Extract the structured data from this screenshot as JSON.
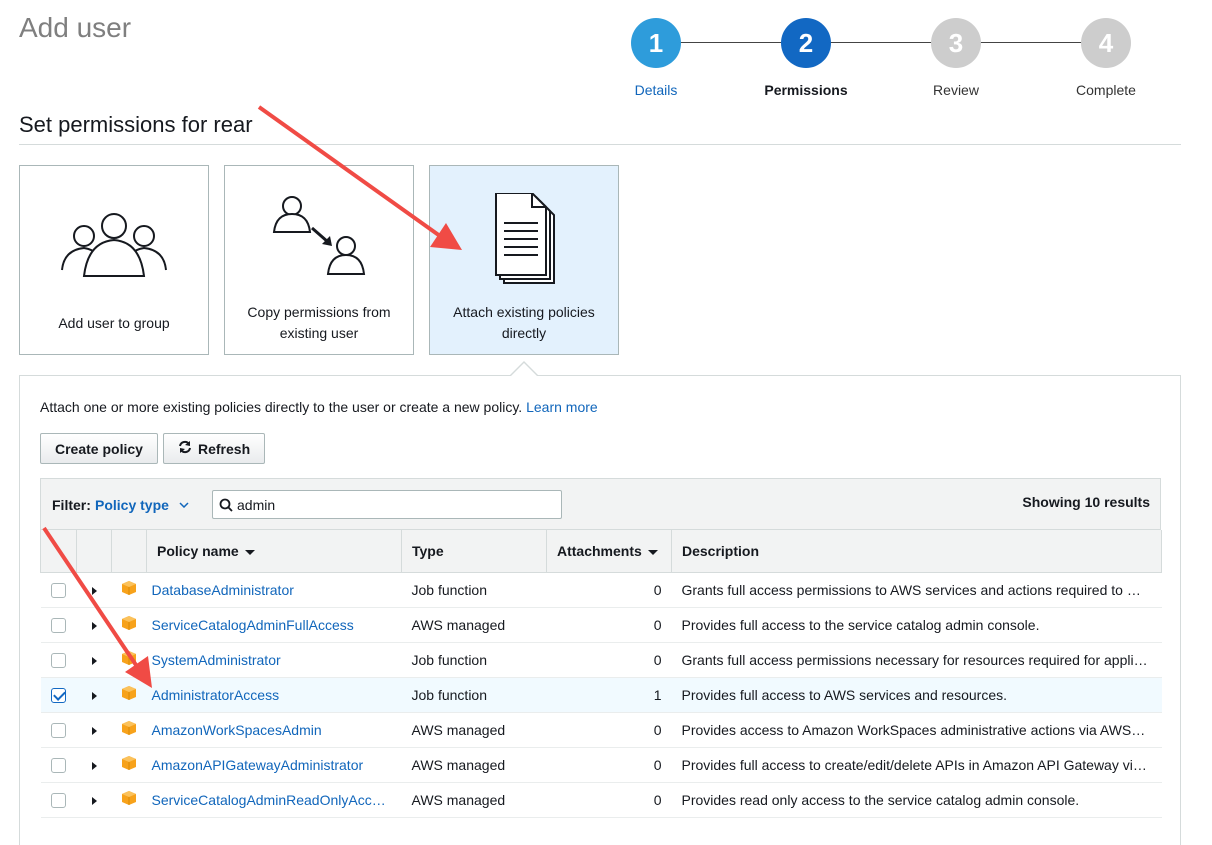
{
  "page": {
    "title": "Add user"
  },
  "stepper": {
    "steps": [
      {
        "number": "1",
        "label": "Details",
        "state": "done"
      },
      {
        "number": "2",
        "label": "Permissions",
        "state": "current"
      },
      {
        "number": "3",
        "label": "Review",
        "state": "future"
      },
      {
        "number": "4",
        "label": "Complete",
        "state": "future"
      }
    ]
  },
  "section": {
    "title": "Set permissions for rear"
  },
  "options": [
    {
      "label": "Add user to group",
      "icon": "users-group-icon",
      "selected": false
    },
    {
      "label": "Copy permissions from existing user",
      "icon": "copy-user-icon",
      "selected": false
    },
    {
      "label": "Attach existing policies directly",
      "icon": "document-stack-icon",
      "selected": true
    }
  ],
  "panel": {
    "intro": "Attach one or more existing policies directly to the user or create a new policy.",
    "learn_more": "Learn more",
    "create_policy": "Create policy",
    "refresh": "Refresh"
  },
  "filter": {
    "label": "Filter:",
    "type": "Policy type",
    "search_value": "admin",
    "results": "Showing 10 results"
  },
  "table": {
    "headers": {
      "name": "Policy name",
      "type": "Type",
      "attachments": "Attachments",
      "description": "Description"
    },
    "rows": [
      {
        "name": "DatabaseAdministrator",
        "type": "Job function",
        "attachments": "0",
        "description": "Grants full access permissions to AWS services and actions required to …",
        "checked": false
      },
      {
        "name": "ServiceCatalogAdminFullAccess",
        "type": "AWS managed",
        "attachments": "0",
        "description": "Provides full access to the service catalog admin console.",
        "checked": false
      },
      {
        "name": "SystemAdministrator",
        "type": "Job function",
        "attachments": "0",
        "description": "Grants full access permissions necessary for resources required for appli…",
        "checked": false
      },
      {
        "name": "AdministratorAccess",
        "type": "Job function",
        "attachments": "1",
        "description": "Provides full access to AWS services and resources.",
        "checked": true
      },
      {
        "name": "AmazonWorkSpacesAdmin",
        "type": "AWS managed",
        "attachments": "0",
        "description": "Provides access to Amazon WorkSpaces administrative actions via AWS…",
        "checked": false
      },
      {
        "name": "AmazonAPIGatewayAdministrator",
        "type": "AWS managed",
        "attachments": "0",
        "description": "Provides full access to create/edit/delete APIs in Amazon API Gateway vi…",
        "checked": false
      },
      {
        "name": "ServiceCatalogAdminReadOnlyAcc…",
        "type": "AWS managed",
        "attachments": "0",
        "description": "Provides read only access to the service catalog admin console.",
        "checked": false
      }
    ]
  },
  "colors": {
    "accent": "#1268c3",
    "link": "#1166bb",
    "annotation_arrow": "#f04b45",
    "policy_icon": "#f7a21b"
  }
}
